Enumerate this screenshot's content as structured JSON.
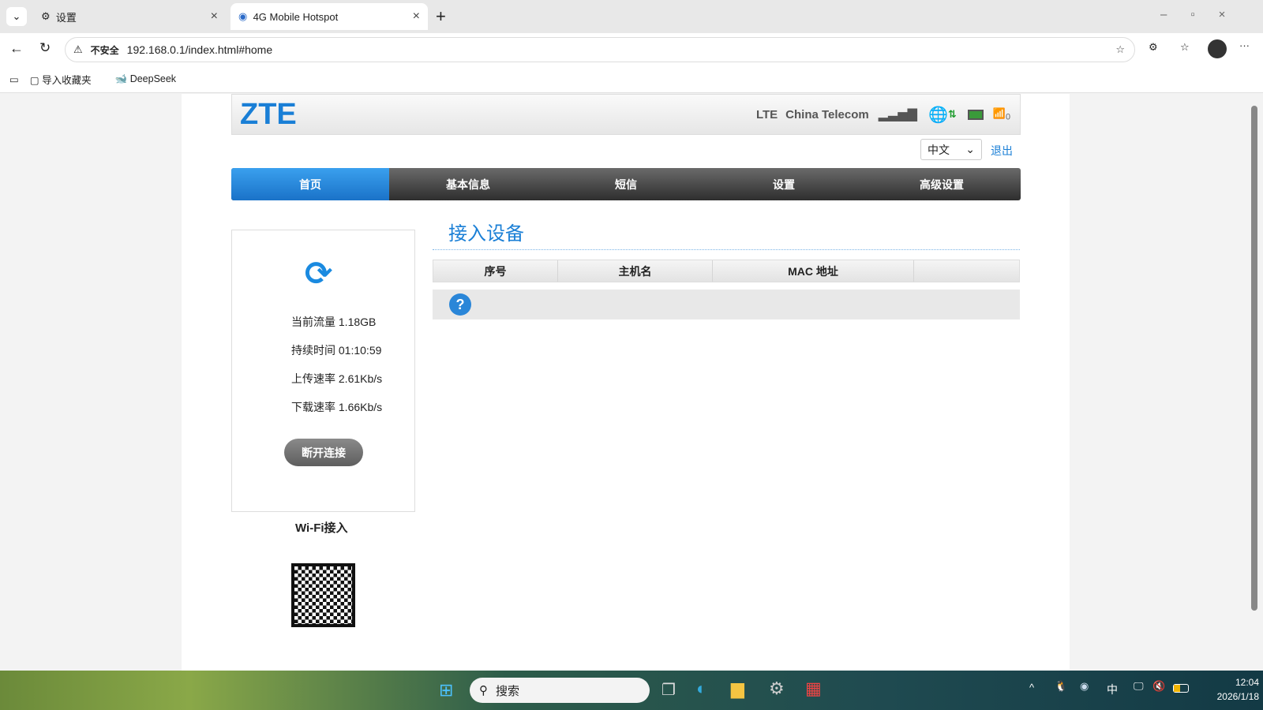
{
  "browser": {
    "tabs": [
      {
        "title": "设置",
        "icon": "gear-icon"
      },
      {
        "title": "4G Mobile Hotspot",
        "icon": "globe-icon"
      }
    ],
    "security": "不安全",
    "url": "192.168.0.1/index.html#home",
    "bookmarks": [
      "导入收藏夹",
      "DeepSeek"
    ]
  },
  "router": {
    "logo": "ZTE",
    "network_type": "LTE",
    "carrier": "China Telecom",
    "wifi_clients": "0",
    "language": "中文",
    "logout": "退出",
    "nav": [
      "首页",
      "基本信息",
      "短信",
      "设置",
      "高级设置"
    ],
    "stats": {
      "traffic": "当前流量 1.18GB",
      "duration": "持续时间 01:10:59",
      "upload": "上传速率 2.61Kb/s",
      "download": "下载速率 1.66Kb/s"
    },
    "disconnect": "断开连接",
    "wifi_access": "Wi-Fi接入",
    "section_title": "接入设备",
    "table_headers": [
      "序号",
      "主机名",
      "MAC 地址",
      ""
    ]
  },
  "taskbar": {
    "search": "搜索",
    "ime": "中",
    "time": "12:04",
    "date": "2026/1/18"
  }
}
